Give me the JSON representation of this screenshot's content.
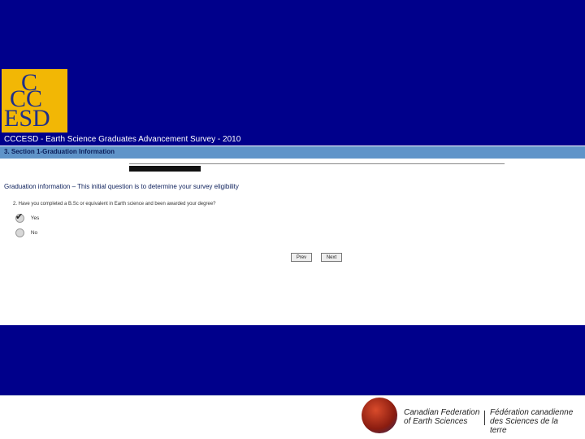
{
  "logo": {
    "line1": "C",
    "line2": "CC",
    "line3": "ESD"
  },
  "header": {
    "survey_title": "CCCESD - Earth Science Graduates Advancement Survey - 2010",
    "section": "3. Section 1-Graduation Information"
  },
  "main": {
    "heading": "Graduation information – This initial question is to determine your survey eligibility",
    "question": "2. Have you completed a B.Sc or equivalent in Earth science and been awarded your degree?",
    "options": [
      {
        "label": "Yes",
        "selected": true
      },
      {
        "label": "No",
        "selected": false
      }
    ],
    "buttons": {
      "prev": "Prev",
      "next": "Next"
    }
  },
  "footer": {
    "org_en_1": "Canadian Federation",
    "org_en_2": "of Earth Sciences",
    "org_fr_1": "Fédération canadienne",
    "org_fr_2": "des Sciences de la terre"
  },
  "colors": {
    "band": "#00008b",
    "logo_bg": "#f2b705",
    "section_bar": "#5f94c9"
  }
}
